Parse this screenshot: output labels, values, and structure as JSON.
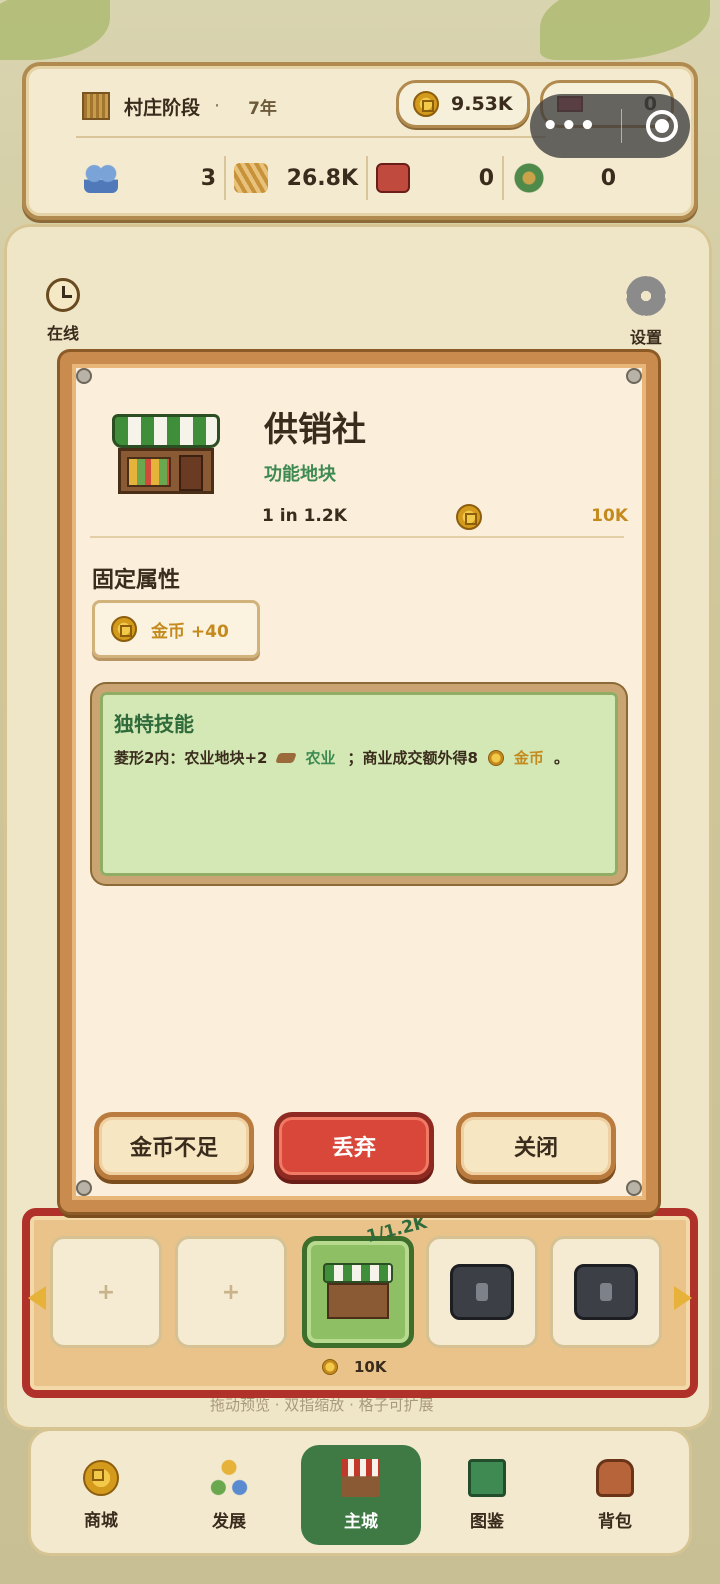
{
  "topbar": {
    "stage_label": "村庄阶段",
    "stage_dot": "·",
    "stage_year": "7年",
    "coins": "9.53K",
    "gems": "0",
    "resources": [
      {
        "icon": "population-icon",
        "value": "3"
      },
      {
        "icon": "grain-icon",
        "value": "26.8K"
      },
      {
        "icon": "goods-bag-icon",
        "value": "0"
      },
      {
        "icon": "flower-icon",
        "value": "0"
      }
    ]
  },
  "miniprogram_capsule": {
    "menu": "•••"
  },
  "side": {
    "online_label": "在线",
    "settings_label": "设置"
  },
  "dialog": {
    "title": "供销社",
    "subtitle": "功能地块",
    "count": "1 in 1.2K",
    "price": "10K",
    "fixed_title": "固定属性",
    "fixed_attr": "金币 +40",
    "skill_title": "独特技能",
    "skill_part1": "菱形2内：农业地块+2",
    "skill_farm": "农业",
    "skill_part2": "；商业成交额外得8",
    "skill_coin": "金币",
    "skill_end": "。",
    "buttons": {
      "insufficient": "金币不足",
      "discard": "丢弃",
      "close": "关闭"
    }
  },
  "slots": {
    "empty_symbol": "+",
    "active_tag": "1/1.2K",
    "active_price": "10K",
    "hint": "拖动预览 · 双指缩放 · 格子可扩展"
  },
  "tabs": [
    {
      "label": "商城",
      "icon": "coin-icon"
    },
    {
      "label": "发展",
      "icon": "development-icon"
    },
    {
      "label": "主城",
      "icon": "shop-icon"
    },
    {
      "label": "图鉴",
      "icon": "book-icon"
    },
    {
      "label": "背包",
      "icon": "backpack-icon"
    }
  ],
  "colors": {
    "accent_green": "#3e8a52",
    "gold": "#c48a1e",
    "frame": "#c98c4e",
    "danger": "#d9473a"
  }
}
